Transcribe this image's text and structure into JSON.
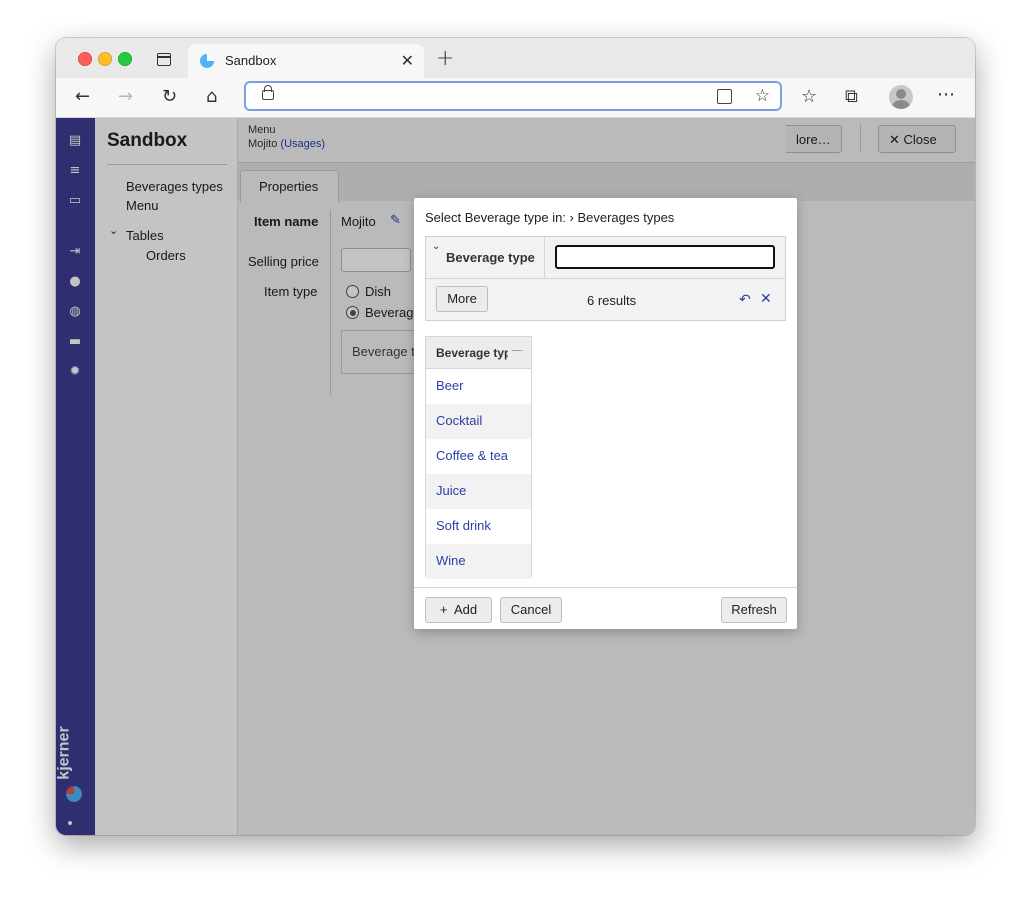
{
  "browser": {
    "tab_title": "Sandbox",
    "tab_close": "✕",
    "new_tab": "+",
    "url": ""
  },
  "sidebar": {
    "title": "Sandbox",
    "items": [
      {
        "label": "Beverages types"
      },
      {
        "label": "Menu"
      },
      {
        "label": "Tables"
      },
      {
        "label": "Orders"
      }
    ],
    "tree_toggle": "⌄"
  },
  "brand": {
    "name": "kjerner"
  },
  "main": {
    "breadcrumb_parent": "Menu",
    "breadcrumb_item": "Mojito",
    "usages_link": "(Usages)",
    "more_button": "lore…",
    "close_button": "Close",
    "close_icon": "✕",
    "tab_properties": "Properties",
    "form": {
      "item_name_label": "Item name",
      "item_name_value": "Mojito",
      "selling_price_label": "Selling price",
      "item_type_label": "Item type",
      "option_dish": "Dish",
      "option_beverage": "Beverage",
      "beverage_type_label": "Beverage ty"
    }
  },
  "dialog": {
    "title": "Select Beverage type in:  › Beverages types",
    "filter_label": "Beverage type",
    "filter_value": "",
    "more_button": "More",
    "results": "6 results",
    "grid_header": "Beverage type",
    "rows": [
      {
        "label": "Beer"
      },
      {
        "label": "Cocktail"
      },
      {
        "label": "Coffee & tea"
      },
      {
        "label": "Juice"
      },
      {
        "label": "Soft drink"
      },
      {
        "label": "Wine"
      }
    ],
    "add_button": "Add",
    "cancel_button": "Cancel",
    "refresh_button": "Refresh"
  },
  "colors": {
    "rail": "#3c3d94",
    "link": "#2b3fa8",
    "url_focus": "#7b9fe0"
  }
}
